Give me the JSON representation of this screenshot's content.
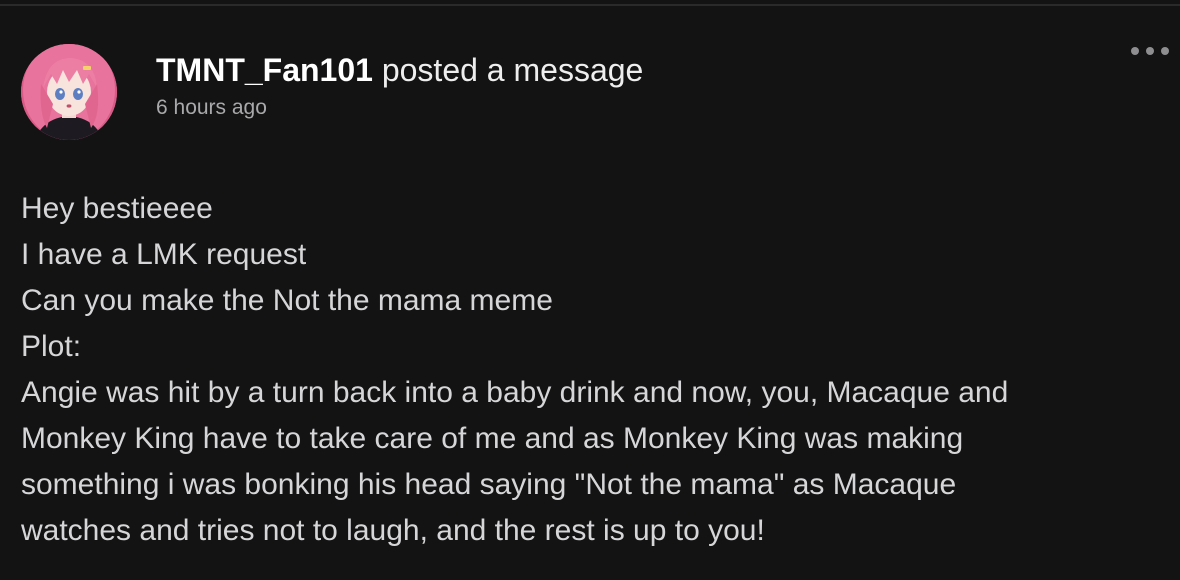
{
  "post": {
    "username": "TMNT_Fan101",
    "action": " posted a message",
    "timestamp": "6 hours ago",
    "more_icon": "more-horizontal-icon",
    "body_lines": [
      "Hey bestieeee",
      "I have a LMK request",
      "Can you make the Not the mama meme",
      "Plot:",
      "Angie was hit by a turn back into a baby drink and now, you, Macaque and",
      "Monkey King have to take care of me and as Monkey King was making",
      "something i was bonking his head saying \"Not the mama\" as Macaque",
      "watches and tries not to laugh, and the rest is up to you!"
    ]
  },
  "colors": {
    "background": "#131314",
    "text_primary": "#ffffff",
    "text_body": "#d6d6d8",
    "text_muted": "#a9a9ab",
    "avatar_hair": "#e8739c"
  }
}
